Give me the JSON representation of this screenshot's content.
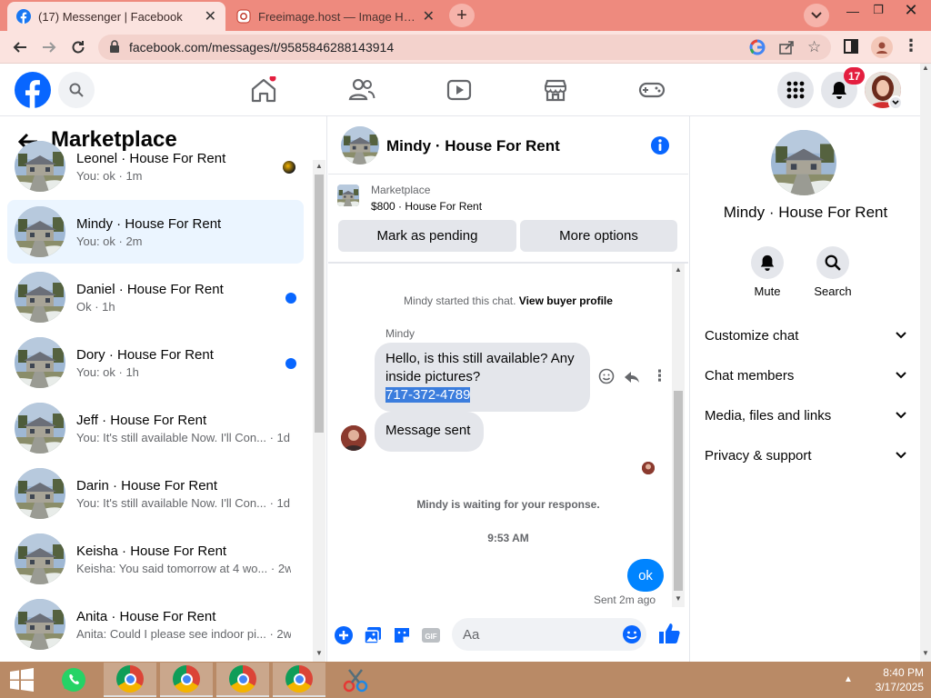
{
  "browser": {
    "tabs": [
      {
        "title": "(17) Messenger | Facebook",
        "active": true,
        "icon": "facebook-icon"
      },
      {
        "title": "Freeimage.host — Image Hosting",
        "active": false,
        "icon": "freeimage-icon"
      }
    ],
    "url": "facebook.com/messages/t/9585846288143914"
  },
  "header": {
    "notification_count": "17",
    "nav_icons": [
      "home-icon",
      "friends-icon",
      "watch-icon",
      "marketplace-icon",
      "gaming-icon"
    ]
  },
  "sidebar": {
    "title": "Marketplace",
    "conversations": [
      {
        "name": "Leonel · House For Rent",
        "preview": "You: ok · 1m",
        "unread": false
      },
      {
        "name": "Mindy · House For Rent",
        "preview": "You: ok · 2m",
        "unread": false,
        "selected": true
      },
      {
        "name": "Daniel · House For Rent",
        "preview": "Ok · 1h",
        "unread": true
      },
      {
        "name": "Dory · House For Rent",
        "preview": "You: ok · 1h",
        "unread": true
      },
      {
        "name": "Jeff · House For Rent",
        "preview": "You: It's still available Now. I'll Con...",
        "time": "· 1d",
        "unread": false
      },
      {
        "name": "Darin · House For Rent",
        "preview": "You: It's still available Now. I'll Con...",
        "time": "· 1d",
        "unread": false
      },
      {
        "name": "Keisha · House For Rent",
        "preview": "Keisha: You said tomorrow at 4 wo...",
        "time": "· 2w",
        "unread": false
      },
      {
        "name": "Anita · House For Rent",
        "preview": "Anita: Could I please see indoor pi...",
        "time": "· 2w",
        "unread": false
      }
    ]
  },
  "chat": {
    "title": "Mindy · House For Rent",
    "listing_label": "Marketplace",
    "listing_item": "$800 · House For Rent",
    "mark_pending": "Mark as pending",
    "more_options": "More options",
    "started_text": "Mindy started this chat.",
    "view_buyer": "View buyer profile",
    "sender_name": "Mindy",
    "message_1": "Hello, is this still available? Any inside pictures?",
    "phone": "717-372-4789",
    "message_2": "Message sent",
    "waiting": "Mindy is waiting for your response.",
    "time": "9:53 AM",
    "my_message": "ok",
    "sent_status": "Sent 2m ago",
    "input_placeholder": "Aa"
  },
  "details": {
    "name": "Mindy · House For Rent",
    "mute": "Mute",
    "search": "Search",
    "rows": [
      "Customize chat",
      "Chat members",
      "Media, files and links",
      "Privacy & support"
    ]
  },
  "taskbar": {
    "time": "8:40 PM",
    "date": "3/17/2025"
  },
  "colors": {
    "fb_blue": "#0866ff",
    "messenger_blue": "#0084ff",
    "tab_strip": "#ee8a7e"
  }
}
